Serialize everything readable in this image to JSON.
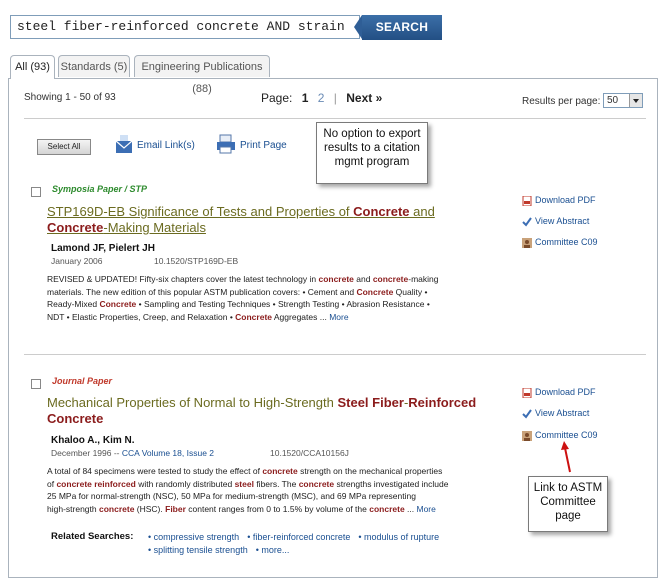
{
  "search": {
    "query": "steel fiber-reinforced concrete AND strain",
    "button_label": "SEARCH"
  },
  "tabs": [
    {
      "label": "All (93)"
    },
    {
      "label": "Standards (5)"
    },
    {
      "label": "Engineering Publications (88)"
    }
  ],
  "results_bar": {
    "showing": "Showing 1 - 50 of 93",
    "page_label": "Page:",
    "page_current": "1",
    "page_other": "2",
    "next_label": "Next »",
    "per_page_label": "Results per page:",
    "per_page_value": "50"
  },
  "tools": {
    "select_all": "Select All",
    "email": "Email Link(s)",
    "print": "Print Page"
  },
  "callouts": {
    "export": [
      "No option to export",
      "results to a citation",
      "mgmt program"
    ],
    "committee": [
      "Link to ASTM",
      "Committee",
      "page"
    ]
  },
  "results": [
    {
      "type": "Symposia Paper / STP",
      "type_color": "#2e8b2e",
      "title_parts": [
        {
          "t": "STP169D-EB Significance of Tests and Properties of ",
          "hl": false
        },
        {
          "t": "Concrete",
          "hl": true
        },
        {
          "t": " and",
          "hl": false
        },
        {
          "t": "Concrete",
          "hl": true
        },
        {
          "t": "-Making Materials",
          "hl": false
        }
      ],
      "authors": "Lamond JF, Pielert JH",
      "date": "January 2006",
      "doi": "10.1520/STP169D-EB",
      "abstract_lines": [
        [
          {
            "t": "REVISED & UPDATED! Fifty-six chapters cover the latest technology in ",
            "hl": false
          },
          {
            "t": "concrete",
            "hl": true
          },
          {
            "t": " and ",
            "hl": false
          },
          {
            "t": "concrete",
            "hl": true
          },
          {
            "t": "-making",
            "hl": false
          }
        ],
        [
          {
            "t": "materials. The new edition of this popular ASTM publication covers: • Cement and ",
            "hl": false
          },
          {
            "t": "Concrete",
            "hl": true
          },
          {
            "t": " Quality •",
            "hl": false
          }
        ],
        [
          {
            "t": "Ready-Mixed ",
            "hl": false
          },
          {
            "t": "Concrete",
            "hl": true
          },
          {
            "t": " • Sampling and Testing Techniques • Strength Testing • Abrasion Resistance •",
            "hl": false
          }
        ],
        [
          {
            "t": "NDT • Elastic Properties, Creep, and Relaxation • ",
            "hl": false
          },
          {
            "t": "Concrete",
            "hl": true
          },
          {
            "t": " Aggregates ... ",
            "hl": false
          }
        ]
      ],
      "more": "More",
      "side_links": [
        "Download PDF",
        "View Abstract",
        "Committee C09"
      ]
    },
    {
      "type": "Journal Paper",
      "type_color": "#c0392b",
      "title_parts": [
        {
          "t": "Mechanical Properties of Normal to High-Strength ",
          "hl": false
        },
        {
          "t": "Steel Fiber",
          "hl": true
        },
        {
          "t": "-",
          "hl": false
        },
        {
          "t": "Reinforced",
          "hl": true
        },
        {
          "t": "Concrete",
          "hl": true
        }
      ],
      "authors": "Khaloo A., Kim N.",
      "date": "December 1996 -- ",
      "journal": "CCA Volume 18, Issue 2",
      "doi": "10.1520/CCA10156J",
      "abstract_lines": [
        [
          {
            "t": "A total of 84 specimens were tested to study the effect of ",
            "hl": false
          },
          {
            "t": "concrete",
            "hl": true
          },
          {
            "t": " strength on the mechanical properties",
            "hl": false
          }
        ],
        [
          {
            "t": "of ",
            "hl": false
          },
          {
            "t": "concrete reinforced",
            "hl": true
          },
          {
            "t": " with randomly distributed ",
            "hl": false
          },
          {
            "t": "steel",
            "hl": true
          },
          {
            "t": " fibers. The ",
            "hl": false
          },
          {
            "t": "concrete",
            "hl": true
          },
          {
            "t": " strengths investigated include",
            "hl": false
          }
        ],
        [
          {
            "t": "25 MPa for normal-strength (NSC), 50 MPa for medium-strength (MSC), and 69 MPa representing",
            "hl": false
          }
        ],
        [
          {
            "t": "high-strength ",
            "hl": false
          },
          {
            "t": "concrete",
            "hl": true
          },
          {
            "t": " (HSC). ",
            "hl": false
          },
          {
            "t": "Fiber",
            "hl": true
          },
          {
            "t": " content ranges from 0 to 1.5% by volume of the ",
            "hl": false
          },
          {
            "t": "concrete",
            "hl": true
          },
          {
            "t": " ... ",
            "hl": false
          }
        ]
      ],
      "more": "More",
      "side_links": [
        "Download PDF",
        "View Abstract",
        "Committee C09"
      ],
      "related_label": "Related Searches:",
      "related_row1": [
        "compressive strength",
        "fiber-reinforced concrete",
        "modulus of rupture"
      ],
      "related_row2": [
        "splitting tensile strength",
        "more..."
      ]
    }
  ]
}
